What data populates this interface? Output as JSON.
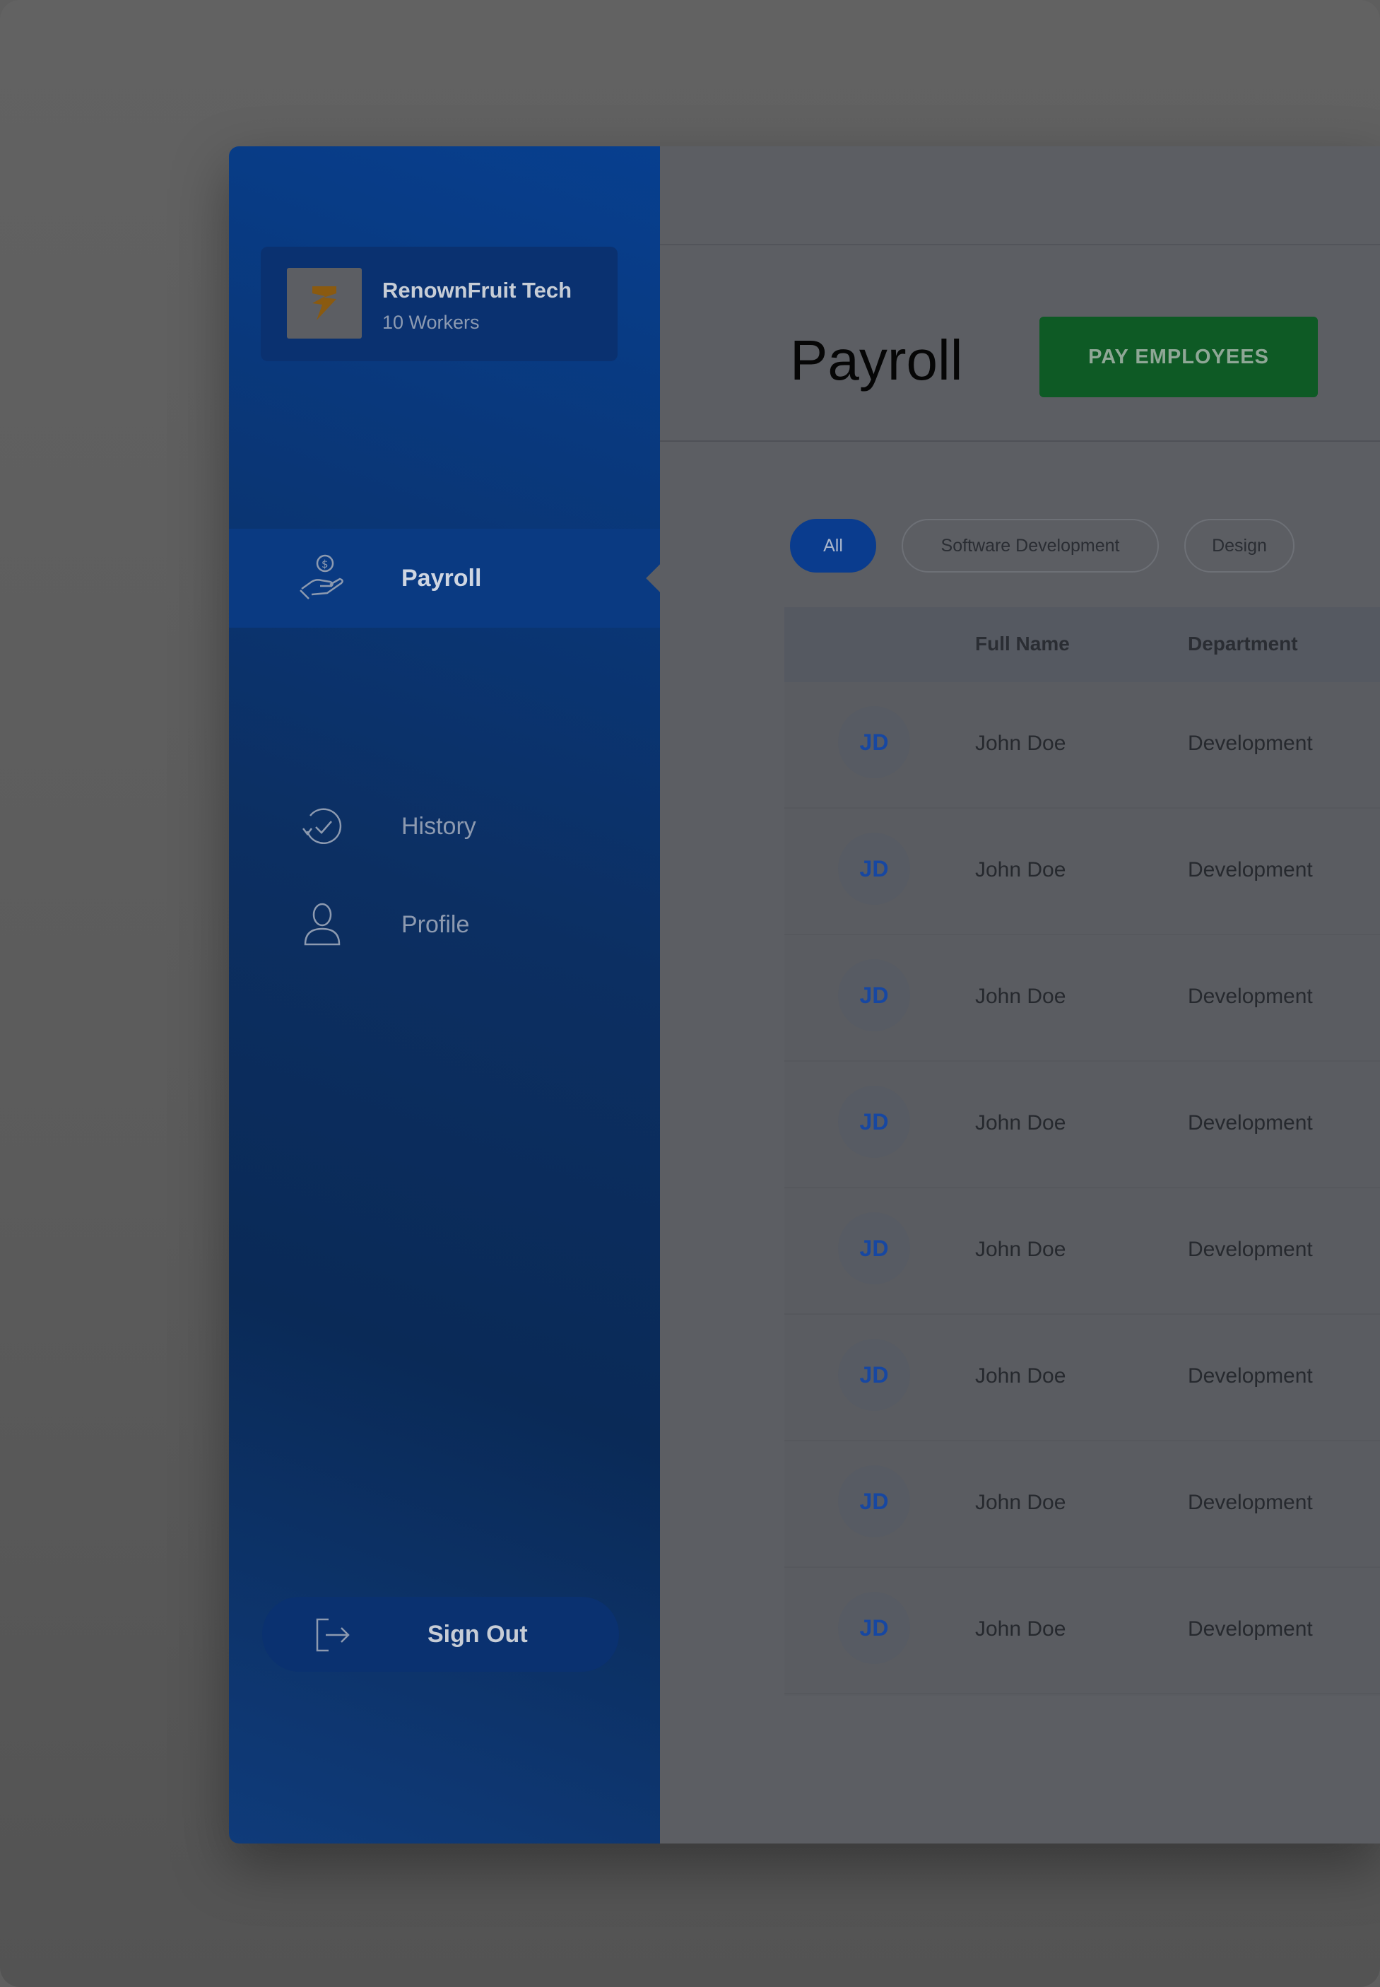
{
  "company": {
    "name": "RenownFruit Tech",
    "workers": "10 Workers"
  },
  "nav": {
    "items": [
      {
        "label": "Payroll",
        "icon": "hand-coin-icon",
        "active": true
      },
      {
        "label": "History",
        "icon": "history-clock-icon",
        "active": false
      },
      {
        "label": "Profile",
        "icon": "user-icon",
        "active": false
      }
    ],
    "sign_out": "Sign Out"
  },
  "header": {
    "title": "Payroll",
    "pay_button": "PAY EMPLOYEES"
  },
  "filters": [
    "All",
    "Software Development",
    "Design"
  ],
  "table": {
    "columns": [
      "Full Name",
      "Department"
    ],
    "rows": [
      {
        "initials": "JD",
        "name": "John Doe",
        "department": "Development"
      },
      {
        "initials": "JD",
        "name": "John Doe",
        "department": "Development"
      },
      {
        "initials": "JD",
        "name": "John Doe",
        "department": "Development"
      },
      {
        "initials": "JD",
        "name": "John Doe",
        "department": "Development"
      },
      {
        "initials": "JD",
        "name": "John Doe",
        "department": "Development"
      },
      {
        "initials": "JD",
        "name": "John Doe",
        "department": "Development"
      },
      {
        "initials": "JD",
        "name": "John Doe",
        "department": "Development"
      },
      {
        "initials": "JD",
        "name": "John Doe",
        "department": "Development"
      }
    ]
  },
  "colors": {
    "sidebar": "#0c2f62",
    "accent_blue": "#0a3c8e",
    "pay_button": "#0e5a25",
    "avatar_text": "#1747a1"
  }
}
